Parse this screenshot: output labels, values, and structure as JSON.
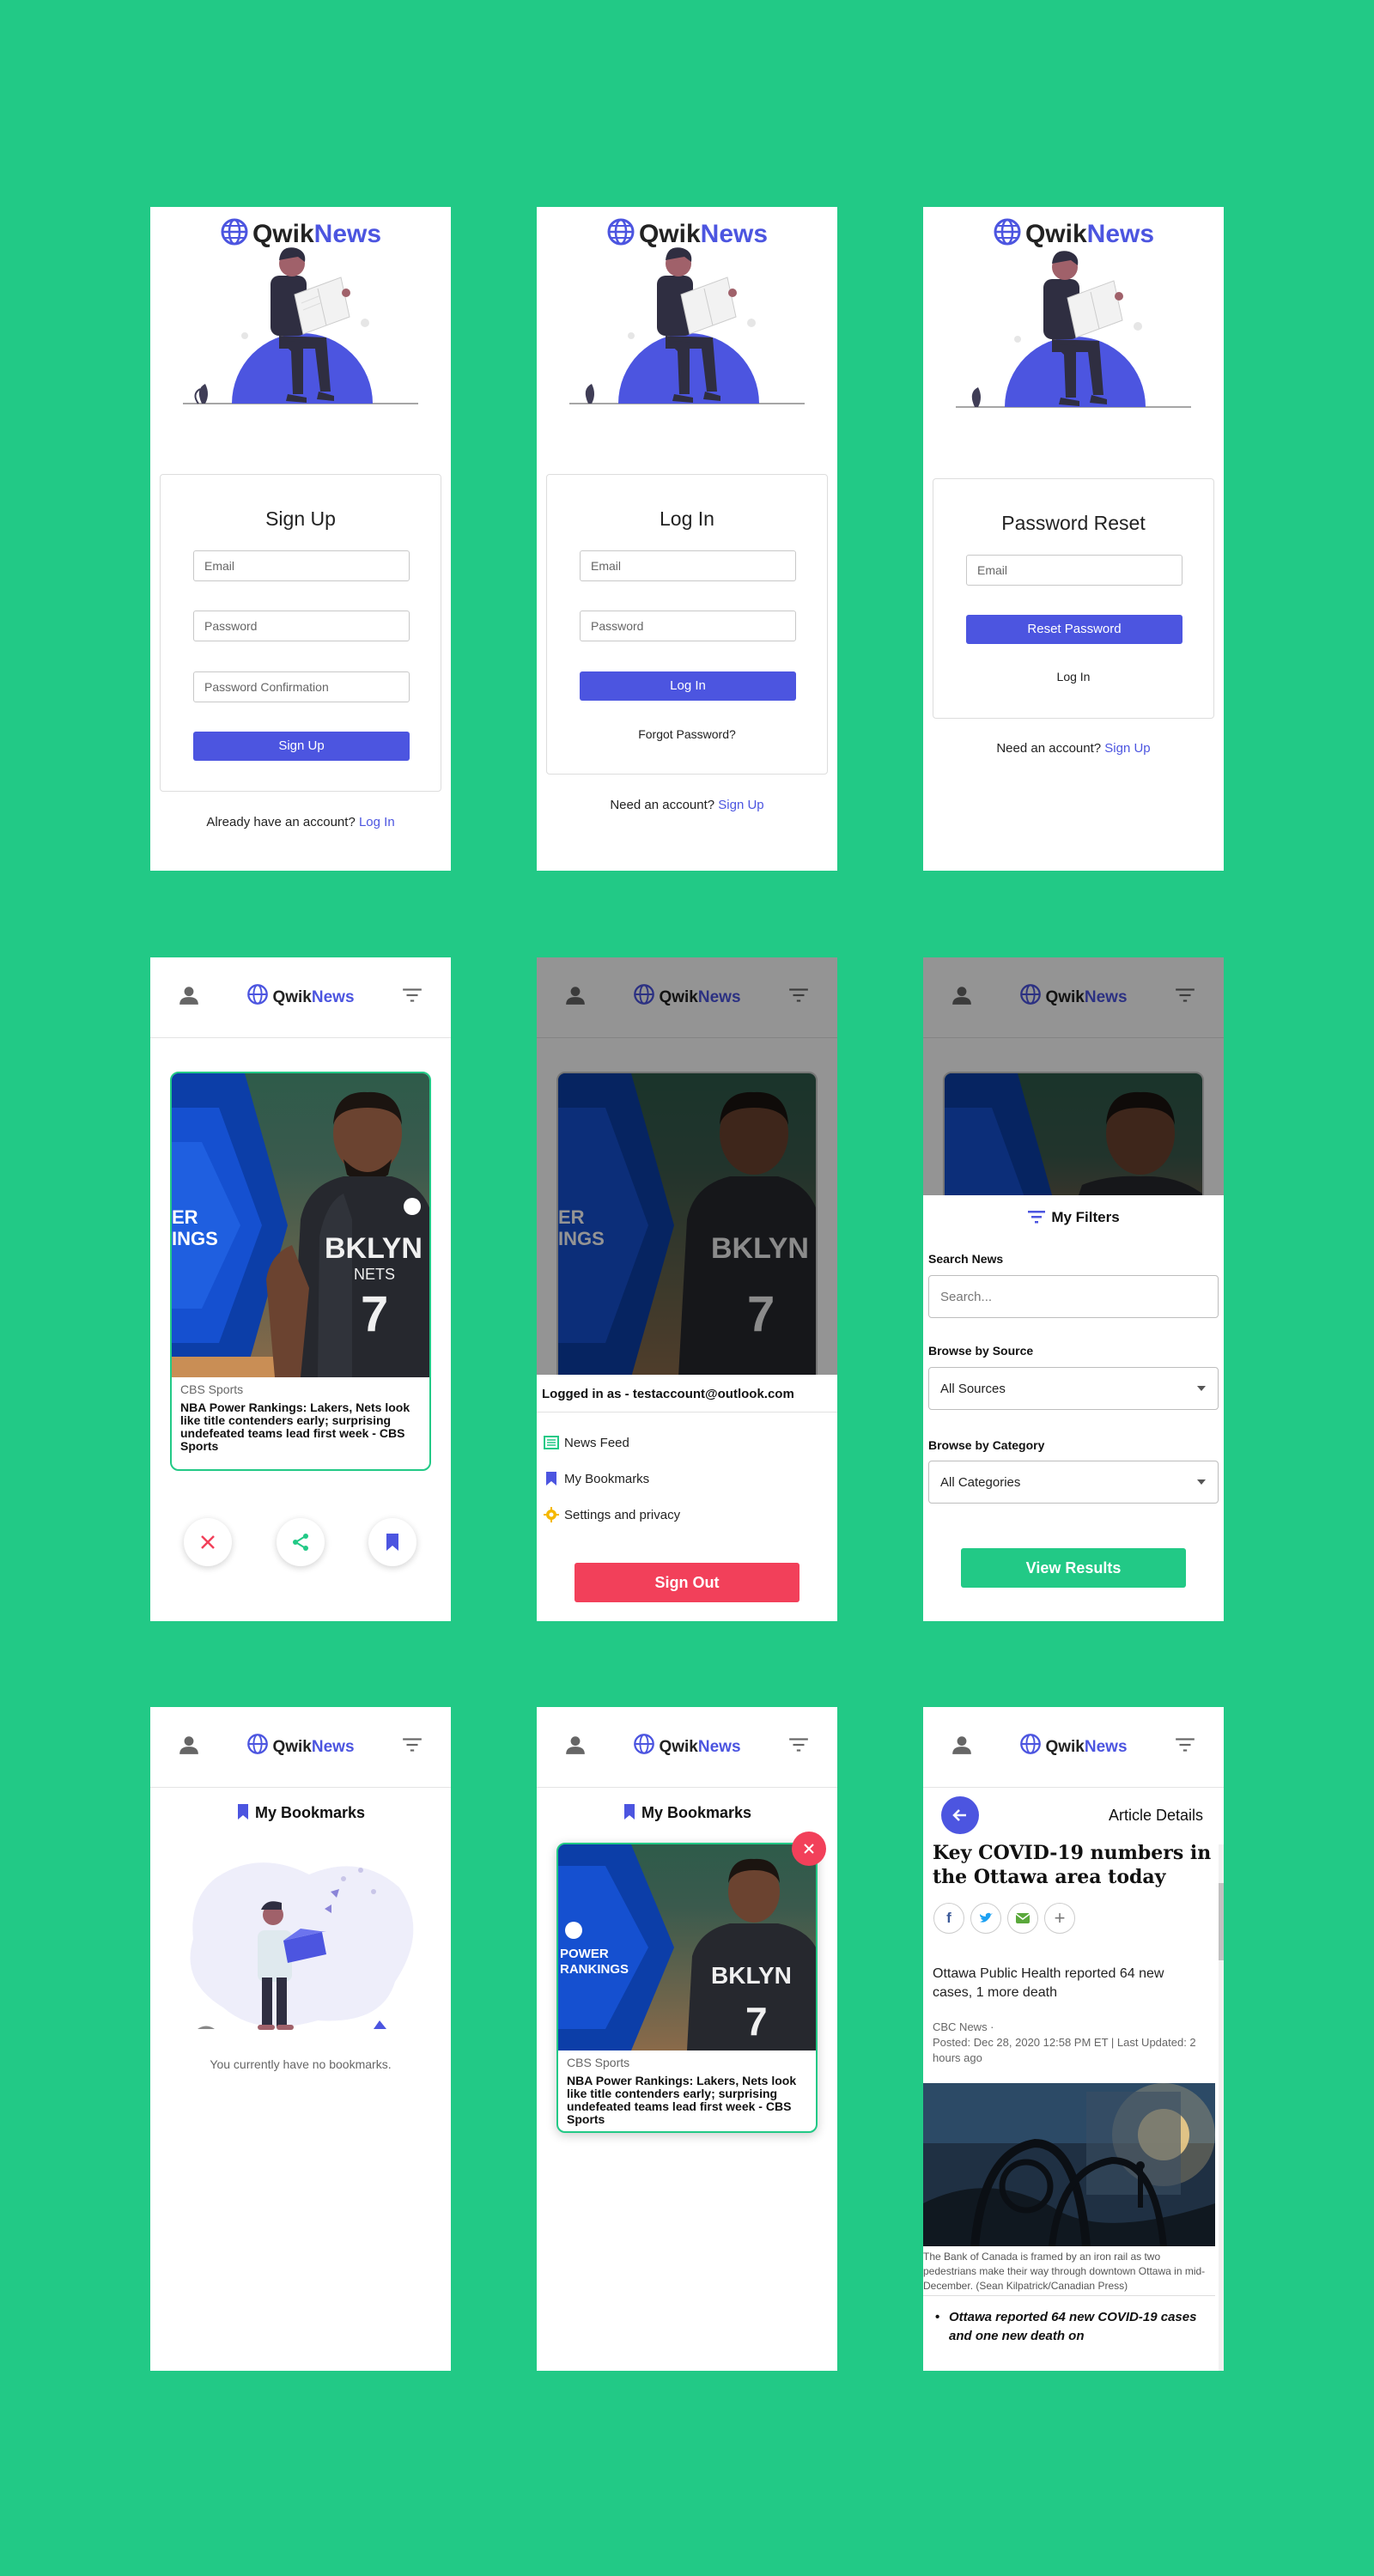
{
  "brand": {
    "part1": "Qwik",
    "part2": "News"
  },
  "signup": {
    "title": "Sign Up",
    "email_placeholder": "Email",
    "password_placeholder": "Password",
    "confirm_placeholder": "Password Confirmation",
    "button": "Sign Up",
    "footer_text": "Already have an account?",
    "footer_link": "Log In"
  },
  "login": {
    "title": "Log In",
    "email_placeholder": "Email",
    "password_placeholder": "Password",
    "button": "Log In",
    "forgot_link": "Forgot Password?",
    "footer_text": "Need an account?",
    "footer_link": "Sign Up"
  },
  "reset": {
    "title": "Password Reset",
    "email_placeholder": "Email",
    "button": "Reset Password",
    "login_link": "Log In",
    "footer_text": "Need an account?",
    "footer_link": "Sign Up"
  },
  "article_card": {
    "source": "CBS Sports",
    "title": "NBA Power Rankings: Lakers, Nets look like title contenders early; surprising undefeated teams lead first week - CBS Sports",
    "image_text_1": "ER",
    "image_text_2": "INGS",
    "image_text_3": "POWER",
    "image_text_4": "RANKINGS",
    "jersey_team": "BKLYN",
    "jersey_sub": "NETS",
    "jersey_number": "7"
  },
  "account_menu": {
    "logged_in_text": "Logged in as - testaccount@outlook.com",
    "items": [
      {
        "label": "News Feed",
        "icon": "newspaper-icon",
        "color": "#22c986"
      },
      {
        "label": "My Bookmarks",
        "icon": "bookmark-icon",
        "color": "#4c55e0"
      },
      {
        "label": "Settings and privacy",
        "icon": "gear-icon",
        "color": "#f5b800"
      }
    ],
    "sign_out": "Sign Out"
  },
  "filters": {
    "title": "My Filters",
    "search_label": "Search News",
    "search_placeholder": "Search...",
    "source_label": "Browse by Source",
    "source_value": "All Sources",
    "category_label": "Browse by Category",
    "category_value": "All Categories",
    "button": "View Results"
  },
  "bookmarks": {
    "title": "My Bookmarks",
    "empty_text": "You currently have no bookmarks."
  },
  "article_details": {
    "header": "Article Details",
    "headline": "Key COVID-19 numbers in the Ottawa area today",
    "summary": "Ottawa Public Health reported 64 new cases, 1 more death",
    "meta_source": "CBC News ·",
    "meta_posted": "Posted: Dec 28, 2020 12:58 PM ET | Last Updated: 2 hours ago",
    "caption": "The Bank of Canada is framed by an iron rail as two pedestrians make their way through downtown Ottawa in mid-December. (Sean Kilpatrick/Canadian Press)",
    "bullet": "Ottawa reported 64 new COVID-19 cases and one new death on"
  },
  "colors": {
    "background": "#22c986",
    "brand_blue": "#4c55e0",
    "accent_green": "#22c986",
    "danger": "#f2405a"
  }
}
